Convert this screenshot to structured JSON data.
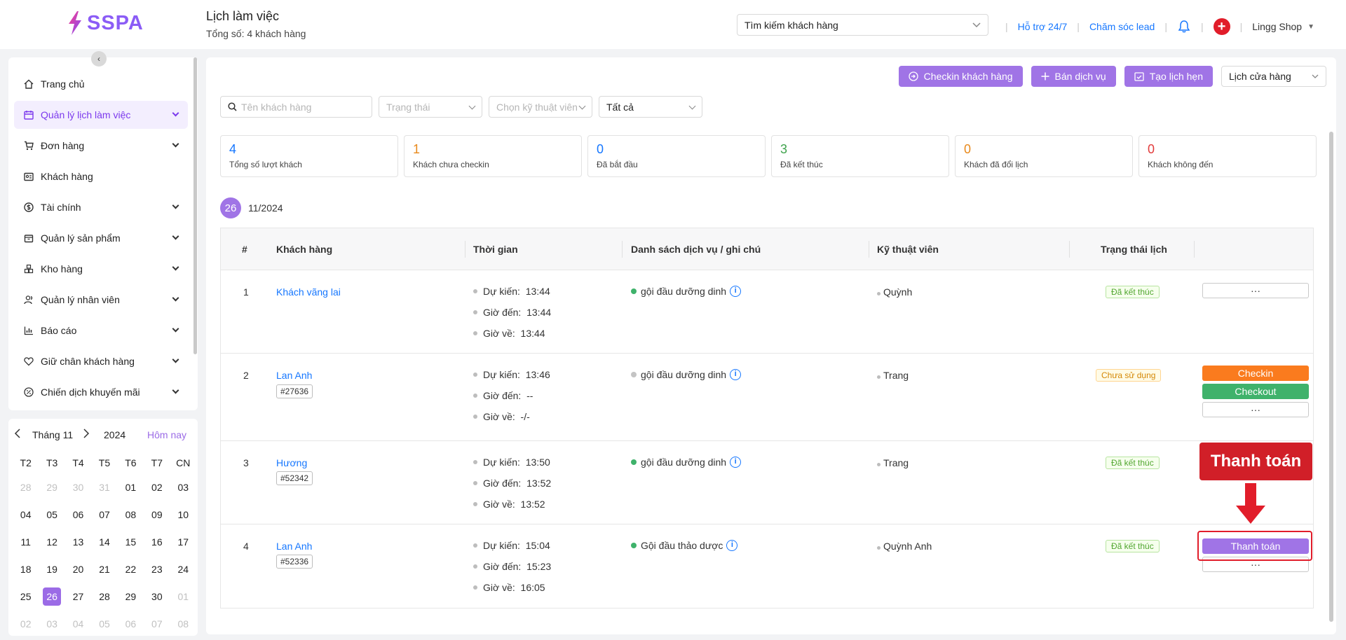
{
  "header": {
    "brand": "SSPA",
    "title": "Lịch làm việc",
    "subtitle": "Tổng số: 4 khách hàng",
    "customer_search": "Tìm kiếm khách hàng",
    "support_link": "Hỗ trợ 24/7",
    "lead_link": "Chăm sóc lead",
    "shop_name": "Lingg Shop",
    "plus_symbol": "+"
  },
  "sidebar": {
    "items": [
      {
        "label": "Trang chủ"
      },
      {
        "label": "Quản lý lịch làm việc"
      },
      {
        "label": "Đơn hàng"
      },
      {
        "label": "Khách hàng"
      },
      {
        "label": "Tài chính"
      },
      {
        "label": "Quản lý sản phẩm"
      },
      {
        "label": "Kho hàng"
      },
      {
        "label": "Quản lý nhân viên"
      },
      {
        "label": "Báo cáo"
      },
      {
        "label": "Giữ chân khách hàng"
      },
      {
        "label": "Chiến dịch khuyến mãi"
      }
    ]
  },
  "calendar": {
    "month": "Tháng 11",
    "year": "2024",
    "today": "Hôm nay",
    "weekdays": [
      "T2",
      "T3",
      "T4",
      "T5",
      "T6",
      "T7",
      "CN"
    ],
    "weeks": [
      [
        "28",
        "29",
        "30",
        "31",
        "01",
        "02",
        "03"
      ],
      [
        "04",
        "05",
        "06",
        "07",
        "08",
        "09",
        "10"
      ],
      [
        "11",
        "12",
        "13",
        "14",
        "15",
        "16",
        "17"
      ],
      [
        "18",
        "19",
        "20",
        "21",
        "22",
        "23",
        "24"
      ],
      [
        "25",
        "26",
        "27",
        "28",
        "29",
        "30",
        "01"
      ],
      [
        "02",
        "03",
        "04",
        "05",
        "06",
        "07",
        "08"
      ]
    ]
  },
  "toolbar": {
    "checkin_label": "Checkin khách hàng",
    "sell_label": "Bán dịch vụ",
    "appointment_label": "Tạo lịch hẹn",
    "store_calendar": "Lịch cửa hàng"
  },
  "filters": {
    "name_placeholder": "Tên khách hàng",
    "status_placeholder": "Trạng thái",
    "tech_placeholder": "Chọn kỹ thuật viên",
    "all": "Tất cả"
  },
  "stats": [
    {
      "value": "4",
      "label": "Tổng số lượt khách",
      "color": "#1677ff"
    },
    {
      "value": "1",
      "label": "Khách chưa checkin",
      "color": "#e8891b"
    },
    {
      "value": "0",
      "label": "Đã bắt đầu",
      "color": "#1677ff"
    },
    {
      "value": "3",
      "label": "Đã kết thúc",
      "color": "#3fa34d"
    },
    {
      "value": "0",
      "label": "Khách đã đổi lịch",
      "color": "#e8891b"
    },
    {
      "value": "0",
      "label": "Khách không đến",
      "color": "#e23b3b"
    }
  ],
  "date_group": {
    "day": "26",
    "month_year": "11/2024"
  },
  "table": {
    "headers": [
      "#",
      "Khách hàng",
      "Thời gian",
      "Danh sách dịch vụ / ghi chú",
      "Kỹ thuật viên",
      "Trạng thái lịch"
    ],
    "time_labels": {
      "expected": "Dự kiến:",
      "arrival": "Giờ đến:",
      "leave": "Giờ về:"
    },
    "more_label": "···",
    "checkin_label": "Checkin",
    "checkout_label": "Checkout",
    "pay_label": "Thanh toán",
    "rows": [
      {
        "index": "1",
        "customer": "Khách vãng lai",
        "code": "",
        "expected": "13:44",
        "arrival": "13:44",
        "leave": "13:44",
        "service": "gội đầu dưỡng dinh",
        "service_dot": "#3fb26b",
        "technician": "Quỳnh",
        "status": "Đã kết thúc"
      },
      {
        "index": "2",
        "customer": "Lan Anh",
        "code": "#27636",
        "expected": "13:46",
        "arrival": "--",
        "leave": "-/-",
        "service": "gội đầu dưỡng dinh",
        "service_dot": "#c4c4c4",
        "technician": "Trang",
        "status": "Chưa sử dụng"
      },
      {
        "index": "3",
        "customer": "Hương",
        "code": "#52342",
        "expected": "13:50",
        "arrival": "13:52",
        "leave": "13:52",
        "service": "gội đầu dưỡng dinh",
        "service_dot": "#3fb26b",
        "technician": "Trang",
        "status": "Đã kết thúc"
      },
      {
        "index": "4",
        "customer": "Lan Anh",
        "code": "#52336",
        "expected": "15:04",
        "arrival": "15:23",
        "leave": "16:05",
        "service": "Gội đầu thảo dược",
        "service_dot": "#3fb26b",
        "technician": "Quỳnh Anh",
        "status": "Đã kết thúc"
      }
    ]
  },
  "annotation": {
    "callout": "Thanh toán"
  },
  "colors": {
    "accent": "#a074e6",
    "link": "#1677ff",
    "danger": "#e11d2a"
  }
}
